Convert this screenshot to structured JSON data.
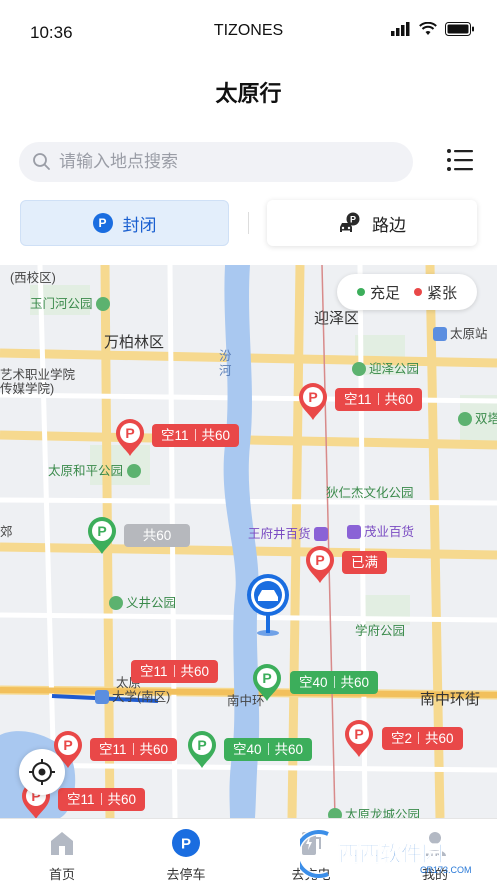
{
  "status_bar": {
    "time": "10:36",
    "carrier": "TIZONES"
  },
  "header": {
    "title": "太原行"
  },
  "search": {
    "placeholder": "请输入地点搜索"
  },
  "tabs": [
    {
      "label": "封闭",
      "icon": "parking-icon",
      "active": true
    },
    {
      "label": "路边",
      "icon": "roadside-parking-icon",
      "active": false
    }
  ],
  "legend": [
    {
      "label": "充足",
      "color": "#3cae5b"
    },
    {
      "label": "紧张",
      "color": "#e94848"
    }
  ],
  "map_labels": {
    "xixiao": "(西校区)",
    "yumenhe": "玉门河公园",
    "wanbailin": "万柏林区",
    "yingze": "迎泽区",
    "taiyuan_station": "太原站",
    "fen": "汾",
    "he": "河",
    "yingze_park": "迎泽公园",
    "college1": "艺术职业学院",
    "college2": "传媒学院)",
    "shuangta": "双塔公",
    "heping": "太原和平公园",
    "direnjie": "狄仁杰文化公园",
    "wangfujing": "王府井百货",
    "maoye": "茂业百货",
    "jiao": "郊",
    "yijing": "义井公园",
    "xuefu": "学府公园",
    "taiyuan_u1": "太原",
    "taiyuan_u2": "大学(南区)",
    "nanzhonghuan1": "南中环",
    "nanzhonghuan2": "南中环街",
    "longcheng": "太原龙城公园"
  },
  "parking_pins": [
    {
      "id": "p1",
      "status": "red",
      "free": "空11",
      "total": "共60"
    },
    {
      "id": "p2",
      "status": "red",
      "free": "空11",
      "total": "共60"
    },
    {
      "id": "p3",
      "status": "gray",
      "free": "",
      "total": "共60"
    },
    {
      "id": "p4",
      "status": "red",
      "full": "已满"
    },
    {
      "id": "p5",
      "status": "red",
      "free": "空11",
      "total": "共60"
    },
    {
      "id": "p6",
      "status": "green",
      "free": "空40",
      "total": "共60"
    },
    {
      "id": "p7",
      "status": "red",
      "free": "空2",
      "total": "共60"
    },
    {
      "id": "p8",
      "status": "red",
      "free": "空11",
      "total": "共60"
    },
    {
      "id": "p9",
      "status": "green",
      "free": "空40",
      "total": "共60"
    },
    {
      "id": "p10",
      "status": "red",
      "free": "空11",
      "total": "共60"
    }
  ],
  "bottom_nav": [
    {
      "label": "首页",
      "icon": "home-icon"
    },
    {
      "label": "去停车",
      "icon": "parking-icon"
    },
    {
      "label": "去充电",
      "icon": "charging-icon"
    },
    {
      "label": "我的",
      "icon": "profile-icon"
    }
  ],
  "watermark": {
    "text": "西西软件园",
    "url_text": "CR173.COM"
  }
}
